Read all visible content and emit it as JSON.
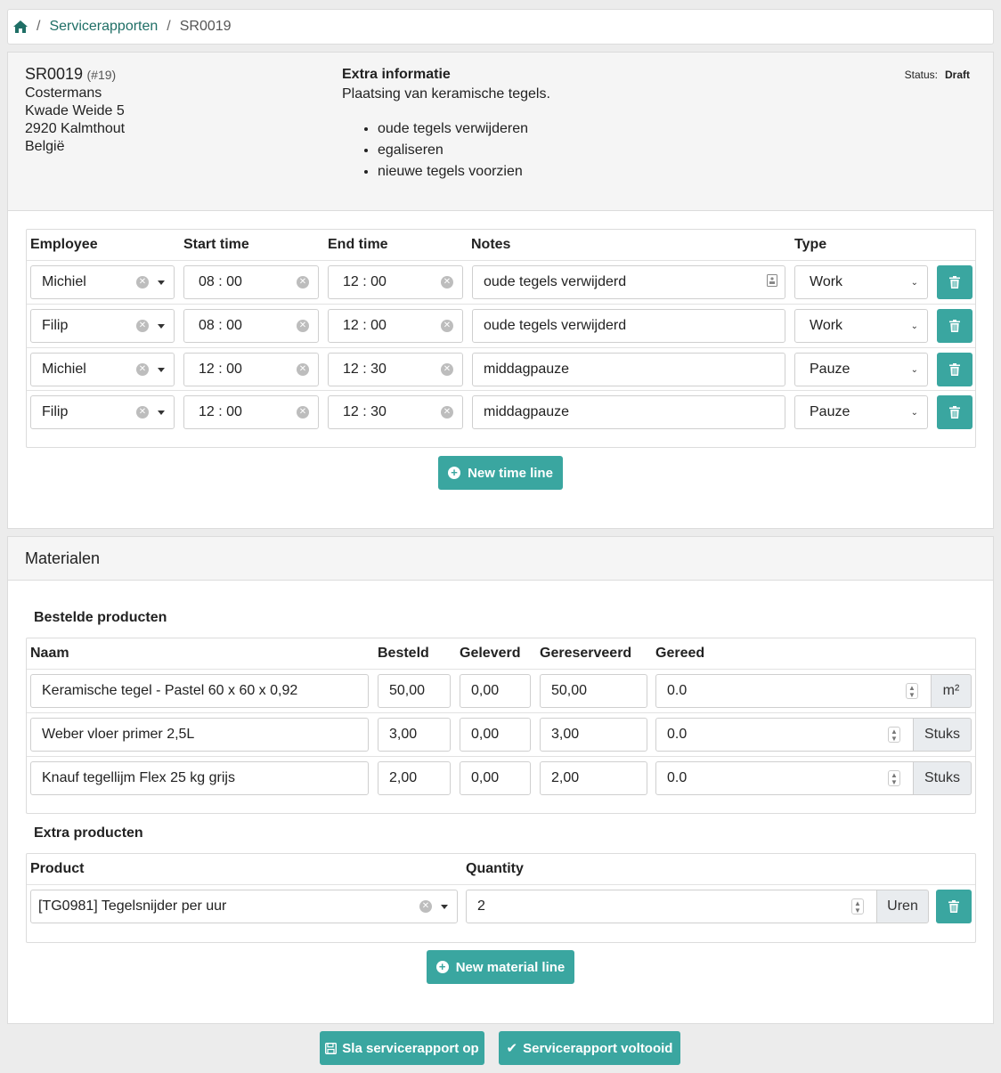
{
  "breadcrumb": {
    "items": [
      "Servicerapporten",
      "SR0019"
    ]
  },
  "report": {
    "id": "SR0019",
    "number": "(#19)",
    "address": [
      "Costermans",
      "Kwade Weide 5",
      "2920 Kalmthout",
      "België"
    ],
    "extra_title": "Extra informatie",
    "extra_text": "Plaatsing van keramische tegels.",
    "extra_items": [
      "oude tegels verwijderen",
      "egaliseren",
      "nieuwe tegels voorzien"
    ],
    "status_label": "Status:",
    "status_value": "Draft"
  },
  "timelines": {
    "headers": {
      "employee": "Employee",
      "start": "Start time",
      "end": "End time",
      "notes": "Notes",
      "type": "Type"
    },
    "rows": [
      {
        "employee": "Michiel",
        "start": "08 : 00",
        "end": "12 : 00",
        "notes": "oude tegels verwijderd",
        "type": "Work"
      },
      {
        "employee": "Filip",
        "start": "08 : 00",
        "end": "12 : 00",
        "notes": "oude tegels verwijderd",
        "type": "Work"
      },
      {
        "employee": "Michiel",
        "start": "12 : 00",
        "end": "12 : 30",
        "notes": "middagpauze",
        "type": "Pauze"
      },
      {
        "employee": "Filip",
        "start": "12 : 00",
        "end": "12 : 30",
        "notes": "middagpauze",
        "type": "Pauze"
      }
    ],
    "new_button": "New time line"
  },
  "materials": {
    "title": "Materialen",
    "ordered_title": "Bestelde producten",
    "headers": {
      "name": "Naam",
      "ordered": "Besteld",
      "delivered": "Geleverd",
      "reserved": "Gereserveerd",
      "done": "Gereed"
    },
    "rows": [
      {
        "name": "Keramische tegel - Pastel 60 x 60 x 0,92",
        "ordered": "50,00",
        "delivered": "0,00",
        "reserved": "50,00",
        "done": "0.0",
        "unit": "m²"
      },
      {
        "name": "Weber vloer primer 2,5L",
        "ordered": "3,00",
        "delivered": "0,00",
        "reserved": "3,00",
        "done": "0.0",
        "unit": "Stuks"
      },
      {
        "name": "Knauf tegellijm Flex 25 kg grijs",
        "ordered": "2,00",
        "delivered": "0,00",
        "reserved": "2,00",
        "done": "0.0",
        "unit": "Stuks"
      }
    ],
    "extra_title": "Extra producten",
    "extra_headers": {
      "product": "Product",
      "quantity": "Quantity"
    },
    "extra_rows": [
      {
        "product": "[TG0981] Tegelsnijder per uur",
        "quantity": "2",
        "unit": "Uren"
      }
    ],
    "new_button": "New material line"
  },
  "footer": {
    "save_button": "Sla servicerapport op",
    "complete_button": "Servicerapport voltooid"
  },
  "colors": {
    "accent": "#3aa6a0",
    "link": "#1f6f66"
  }
}
